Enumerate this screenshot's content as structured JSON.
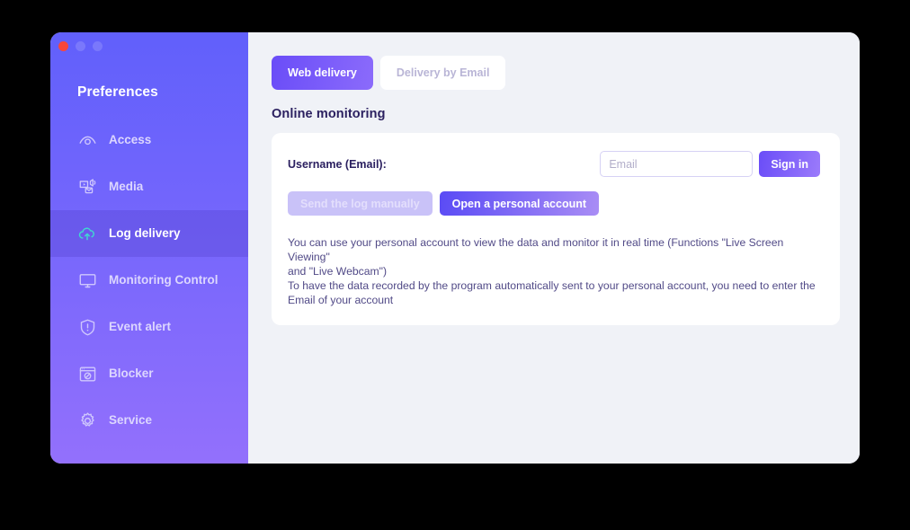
{
  "window": {
    "traffic_lights": [
      "close",
      "minimize",
      "maximize"
    ],
    "accent_purple": "#6160FB",
    "accent_violet": "#9370FC",
    "content_bg": "#F0F2F7"
  },
  "sidebar": {
    "title": "Preferences",
    "active_index": 2,
    "items": [
      {
        "label": "Access",
        "icon": "eye-icon"
      },
      {
        "label": "Media",
        "icon": "media-mail-icon"
      },
      {
        "label": "Log delivery",
        "icon": "cloud-upload-icon"
      },
      {
        "label": "Monitoring Control",
        "icon": "monitor-icon"
      },
      {
        "label": "Event alert",
        "icon": "shield-alert-icon"
      },
      {
        "label": "Blocker",
        "icon": "browser-block-icon"
      },
      {
        "label": "Service",
        "icon": "gear-icon"
      }
    ]
  },
  "main": {
    "tabs": [
      {
        "label": "Web delivery",
        "active": true
      },
      {
        "label": "Delivery by Email",
        "active": false
      }
    ],
    "section_title": "Online monitoring",
    "card": {
      "credential_label": "Username (Email):",
      "email_value": "",
      "email_placeholder": "Email",
      "signin_label": "Sign in",
      "actions": [
        {
          "label": "Send the log manually",
          "state": "disabled"
        },
        {
          "label": "Open a personal account",
          "state": "primary"
        }
      ],
      "description_lines": [
        "You can use your personal account to view the data and monitor it in real time (Functions \"Live Screen Viewing\"",
        "and \"Live Webcam\")",
        "To have the data recorded by the program automatically sent to your personal account, you need to enter the",
        "Email of your account"
      ]
    }
  }
}
